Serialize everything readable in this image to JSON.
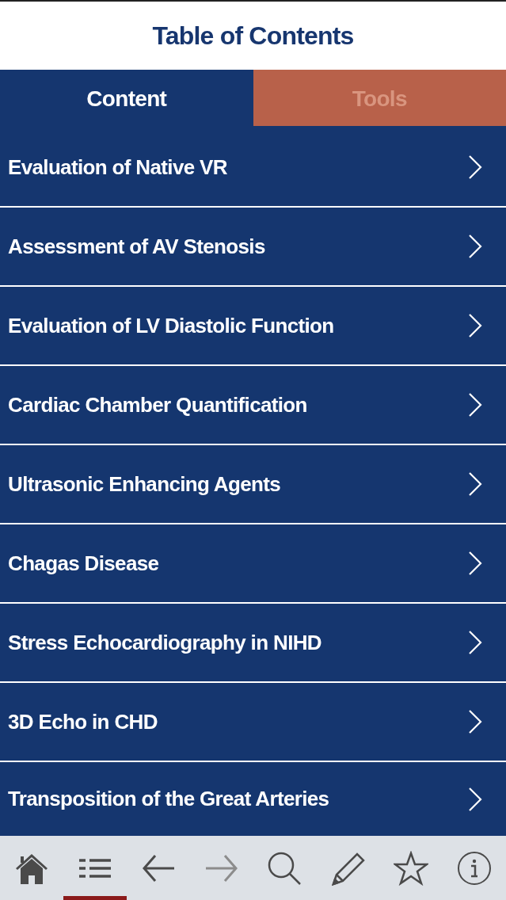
{
  "header": {
    "title": "Table of Contents"
  },
  "tabs": [
    {
      "label": "Content",
      "selected": true
    },
    {
      "label": "Tools",
      "selected": false
    }
  ],
  "items": [
    {
      "title": "Evaluation of Native VR"
    },
    {
      "title": "Assessment of AV Stenosis"
    },
    {
      "title": "Evaluation of LV Diastolic Function"
    },
    {
      "title": "Cardiac Chamber Quantification"
    },
    {
      "title": "Ultrasonic Enhancing Agents"
    },
    {
      "title": "Chagas Disease"
    },
    {
      "title": "Stress Echocardiography in NIHD"
    },
    {
      "title": "3D Echo in CHD"
    },
    {
      "title": "Transposition of the Great Arteries"
    }
  ],
  "toolbar": [
    {
      "kind": "home",
      "selected": false,
      "disabled": false
    },
    {
      "kind": "list",
      "selected": true,
      "disabled": false
    },
    {
      "kind": "back",
      "selected": false,
      "disabled": false
    },
    {
      "kind": "forward",
      "selected": false,
      "disabled": true
    },
    {
      "kind": "search",
      "selected": false,
      "disabled": false
    },
    {
      "kind": "pencil",
      "selected": false,
      "disabled": false
    },
    {
      "kind": "star",
      "selected": false,
      "disabled": false
    },
    {
      "kind": "info",
      "selected": false,
      "disabled": false
    }
  ]
}
